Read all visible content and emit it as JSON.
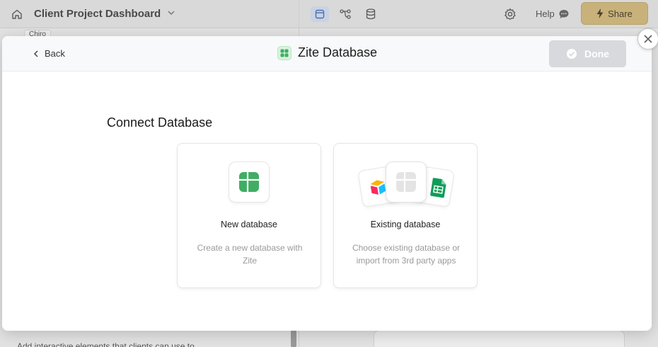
{
  "background": {
    "project_title": "Client Project Dashboard",
    "help_label": "Help",
    "share_label": "Share",
    "chip_label": "Chiro",
    "bottom_text": "Add interactive elements that clients can use to ..."
  },
  "modal": {
    "back_label": "Back",
    "title": "Zite Database",
    "done_label": "Done",
    "section_heading": "Connect Database",
    "cards": [
      {
        "label": "New database",
        "description": "Create a new database with Zite",
        "icon": "grid-table-icon"
      },
      {
        "label": "Existing database",
        "description": "Choose existing database or import from 3rd party apps",
        "icon": "integrations-stack-icon"
      }
    ]
  },
  "colors": {
    "brand_green": "#3fae63",
    "share_gold": "#c8b27a",
    "done_disabled": "#d7d9dd"
  }
}
